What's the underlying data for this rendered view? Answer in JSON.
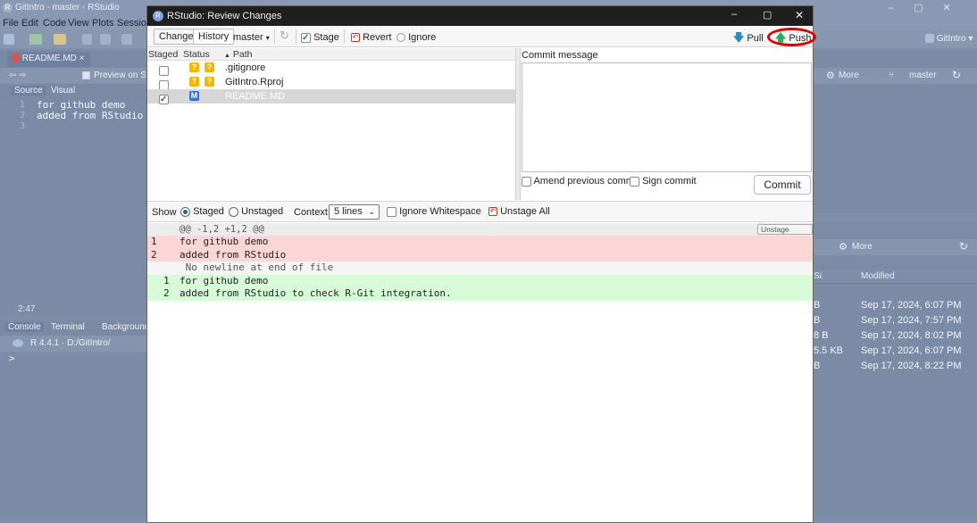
{
  "bg_app": {
    "title": "GitIntro - master - RStudio",
    "menu": [
      "File",
      "Edit",
      "Code",
      "View",
      "Plots",
      "Session"
    ],
    "editor_tab": "README.MD",
    "preview_label": "Preview on Save",
    "source_tab": "Source",
    "visual_tab": "Visual",
    "editor_lines": [
      {
        "num": "1",
        "text": "for github demo"
      },
      {
        "num": "2",
        "text": "added from RStudio to check R-Git integration."
      },
      {
        "num": "3",
        "text": ""
      }
    ],
    "cursor_pos": "2:47",
    "console_tabs": [
      "Console",
      "Terminal",
      "Background Jobs"
    ],
    "console_path": "R 4.4.1 · D:/GitIntro/",
    "console_prompt": ">",
    "project_label": "GitIntro",
    "right_more": "More",
    "right_branch": "master",
    "files_more": "More",
    "files_header_size": "Size",
    "files_header_modified": "Modified",
    "files": [
      {
        "size": "B",
        "modified": "Sep 17, 2024, 6:07 PM"
      },
      {
        "size": "B",
        "modified": "Sep 17, 2024, 7:57 PM"
      },
      {
        "size": "8 B",
        "modified": "Sep 17, 2024, 8:02 PM"
      },
      {
        "size": "5.5 KB",
        "modified": "Sep 17, 2024, 6:07 PM"
      },
      {
        "size": "B",
        "modified": "Sep 17, 2024, 8:22 PM"
      }
    ]
  },
  "dialog": {
    "title": "RStudio: Review Changes",
    "toolbar": {
      "changes": "Changes",
      "history": "History",
      "branch": "master",
      "stage": "Stage",
      "revert": "Revert",
      "ignore": "Ignore",
      "pull": "Pull",
      "push": "Push"
    },
    "columns": {
      "staged": "Staged",
      "status": "Status",
      "path": "Path"
    },
    "files": [
      {
        "staged": false,
        "status": "??",
        "path": ".gitignore"
      },
      {
        "staged": false,
        "status": "??",
        "path": "GitIntro.Rproj"
      },
      {
        "staged": true,
        "status": "M",
        "path": "README.MD"
      }
    ],
    "commit_label": "Commit message",
    "commit_message": "",
    "amend_label": "Amend previous commit",
    "sign_label": "Sign commit",
    "commit_button": "Commit",
    "diff_controls": {
      "show": "Show",
      "staged": "Staged",
      "unstaged": "Unstaged",
      "context": "Context",
      "context_value": "5 lines",
      "ignore_ws": "Ignore Whitespace",
      "unstage_all": "Unstage All"
    },
    "hunk_header": "@@ -1,2 +1,2 @@",
    "unstage_chunk": "Unstage chunk",
    "diff_lines": [
      {
        "old": "1",
        "new": "",
        "text": "for github demo",
        "kind": "del"
      },
      {
        "old": "2",
        "new": "",
        "text": "added from RStudio",
        "kind": "del"
      },
      {
        "old": "",
        "new": "",
        "text": " No newline at end of file",
        "kind": "note"
      },
      {
        "old": "",
        "new": "1",
        "text": "for github demo",
        "kind": "add"
      },
      {
        "old": "",
        "new": "2",
        "text": "added from RStudio to check R-Git integration.",
        "kind": "add"
      }
    ]
  },
  "colors": {
    "highlight_circle": "#e00000",
    "push_arrow": "#27ae60",
    "pull_arrow": "#2e86c1"
  }
}
